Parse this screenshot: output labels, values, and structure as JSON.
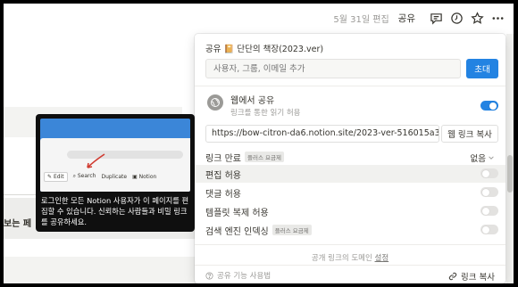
{
  "topbar": {
    "edited": "5월 31일 편집",
    "share": "공유",
    "icons": [
      "comment-icon",
      "clock-icon",
      "star-icon",
      "more-icon"
    ]
  },
  "background": {
    "partial_text": "보는 페"
  },
  "share_popup": {
    "title": "공유 📔 단단의 책장(2023.ver)",
    "invite_placeholder": "사용자, 그룹, 이메일 추가",
    "invite_button": "초대",
    "web_share_title": "웹에서 공유",
    "web_share_sub": "링크를 통한 읽기 허용",
    "web_share_on": true,
    "public_link": "https://bow-citron-da6.notion.site/2023-ver-516015a395fd",
    "copy_web_link": "웹 링크 복사",
    "link_expire_label": "링크 만료",
    "plus_badge": "플러스 요금제",
    "link_expire_value": "없음",
    "allow_edit": "편집 허용",
    "allow_comments": "댓글 허용",
    "allow_duplicate": "템플릿 복제 허용",
    "search_indexing": "검색 엔진 인덱싱",
    "domain_note": "공개 링크의 도메인",
    "domain_setting": "설정",
    "learn_sharing": "공유 기능 사용법",
    "copy_link": "링크 복사"
  },
  "tooltip": {
    "image_toolbar": {
      "edit": "Edit",
      "search": "Search",
      "duplicate": "Duplicate",
      "notion": "Notion"
    },
    "text": "로그인한 모든 Notion 사용자가 이 페이지를 편집할 수 있습니다. 신뢰하는 사람들과 비밀 링크를 공유하세요."
  },
  "colors": {
    "accent": "#2383e2",
    "tooltip_bg": "#0f0f0f",
    "tooltip_image_bg": "#3b86d8"
  }
}
